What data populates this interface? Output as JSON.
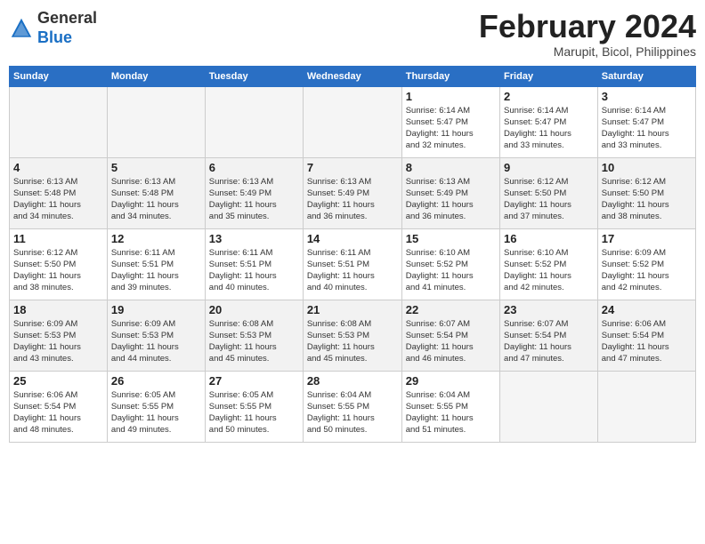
{
  "header": {
    "logo_general": "General",
    "logo_blue": "Blue",
    "month_title": "February 2024",
    "location": "Marupit, Bicol, Philippines"
  },
  "weekdays": [
    "Sunday",
    "Monday",
    "Tuesday",
    "Wednesday",
    "Thursday",
    "Friday",
    "Saturday"
  ],
  "weeks": [
    [
      {
        "day": "",
        "info": ""
      },
      {
        "day": "",
        "info": ""
      },
      {
        "day": "",
        "info": ""
      },
      {
        "day": "",
        "info": ""
      },
      {
        "day": "1",
        "info": "Sunrise: 6:14 AM\nSunset: 5:47 PM\nDaylight: 11 hours\nand 32 minutes."
      },
      {
        "day": "2",
        "info": "Sunrise: 6:14 AM\nSunset: 5:47 PM\nDaylight: 11 hours\nand 33 minutes."
      },
      {
        "day": "3",
        "info": "Sunrise: 6:14 AM\nSunset: 5:47 PM\nDaylight: 11 hours\nand 33 minutes."
      }
    ],
    [
      {
        "day": "4",
        "info": "Sunrise: 6:13 AM\nSunset: 5:48 PM\nDaylight: 11 hours\nand 34 minutes."
      },
      {
        "day": "5",
        "info": "Sunrise: 6:13 AM\nSunset: 5:48 PM\nDaylight: 11 hours\nand 34 minutes."
      },
      {
        "day": "6",
        "info": "Sunrise: 6:13 AM\nSunset: 5:49 PM\nDaylight: 11 hours\nand 35 minutes."
      },
      {
        "day": "7",
        "info": "Sunrise: 6:13 AM\nSunset: 5:49 PM\nDaylight: 11 hours\nand 36 minutes."
      },
      {
        "day": "8",
        "info": "Sunrise: 6:13 AM\nSunset: 5:49 PM\nDaylight: 11 hours\nand 36 minutes."
      },
      {
        "day": "9",
        "info": "Sunrise: 6:12 AM\nSunset: 5:50 PM\nDaylight: 11 hours\nand 37 minutes."
      },
      {
        "day": "10",
        "info": "Sunrise: 6:12 AM\nSunset: 5:50 PM\nDaylight: 11 hours\nand 38 minutes."
      }
    ],
    [
      {
        "day": "11",
        "info": "Sunrise: 6:12 AM\nSunset: 5:50 PM\nDaylight: 11 hours\nand 38 minutes."
      },
      {
        "day": "12",
        "info": "Sunrise: 6:11 AM\nSunset: 5:51 PM\nDaylight: 11 hours\nand 39 minutes."
      },
      {
        "day": "13",
        "info": "Sunrise: 6:11 AM\nSunset: 5:51 PM\nDaylight: 11 hours\nand 40 minutes."
      },
      {
        "day": "14",
        "info": "Sunrise: 6:11 AM\nSunset: 5:51 PM\nDaylight: 11 hours\nand 40 minutes."
      },
      {
        "day": "15",
        "info": "Sunrise: 6:10 AM\nSunset: 5:52 PM\nDaylight: 11 hours\nand 41 minutes."
      },
      {
        "day": "16",
        "info": "Sunrise: 6:10 AM\nSunset: 5:52 PM\nDaylight: 11 hours\nand 42 minutes."
      },
      {
        "day": "17",
        "info": "Sunrise: 6:09 AM\nSunset: 5:52 PM\nDaylight: 11 hours\nand 42 minutes."
      }
    ],
    [
      {
        "day": "18",
        "info": "Sunrise: 6:09 AM\nSunset: 5:53 PM\nDaylight: 11 hours\nand 43 minutes."
      },
      {
        "day": "19",
        "info": "Sunrise: 6:09 AM\nSunset: 5:53 PM\nDaylight: 11 hours\nand 44 minutes."
      },
      {
        "day": "20",
        "info": "Sunrise: 6:08 AM\nSunset: 5:53 PM\nDaylight: 11 hours\nand 45 minutes."
      },
      {
        "day": "21",
        "info": "Sunrise: 6:08 AM\nSunset: 5:53 PM\nDaylight: 11 hours\nand 45 minutes."
      },
      {
        "day": "22",
        "info": "Sunrise: 6:07 AM\nSunset: 5:54 PM\nDaylight: 11 hours\nand 46 minutes."
      },
      {
        "day": "23",
        "info": "Sunrise: 6:07 AM\nSunset: 5:54 PM\nDaylight: 11 hours\nand 47 minutes."
      },
      {
        "day": "24",
        "info": "Sunrise: 6:06 AM\nSunset: 5:54 PM\nDaylight: 11 hours\nand 47 minutes."
      }
    ],
    [
      {
        "day": "25",
        "info": "Sunrise: 6:06 AM\nSunset: 5:54 PM\nDaylight: 11 hours\nand 48 minutes."
      },
      {
        "day": "26",
        "info": "Sunrise: 6:05 AM\nSunset: 5:55 PM\nDaylight: 11 hours\nand 49 minutes."
      },
      {
        "day": "27",
        "info": "Sunrise: 6:05 AM\nSunset: 5:55 PM\nDaylight: 11 hours\nand 50 minutes."
      },
      {
        "day": "28",
        "info": "Sunrise: 6:04 AM\nSunset: 5:55 PM\nDaylight: 11 hours\nand 50 minutes."
      },
      {
        "day": "29",
        "info": "Sunrise: 6:04 AM\nSunset: 5:55 PM\nDaylight: 11 hours\nand 51 minutes."
      },
      {
        "day": "",
        "info": ""
      },
      {
        "day": "",
        "info": ""
      }
    ]
  ]
}
